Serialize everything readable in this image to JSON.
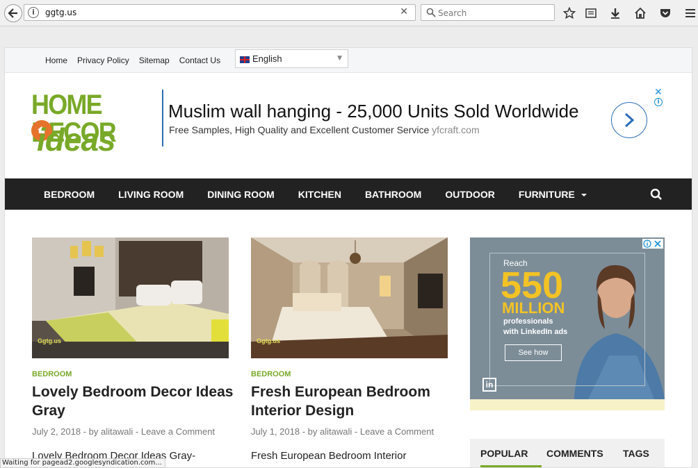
{
  "browser": {
    "url": "ggtg.us",
    "search_placeholder": "Search",
    "status_text": "Waiting for pagead2.googlesyndication.com..."
  },
  "topnav": {
    "items": [
      "Home",
      "Privacy Policy",
      "Sitemap",
      "Contact Us"
    ],
    "language": "English"
  },
  "logo": {
    "line1": "HOME DECOR",
    "line2": "ideas"
  },
  "ad_banner": {
    "headline": "Muslim wall hanging - 25,000 Units Sold Worldwide",
    "subtext": "Free Samples, High Quality and Excellent Customer Service",
    "domain": "yfcraft.com",
    "close": "✕",
    "info": "i"
  },
  "mainnav": {
    "items": [
      "BEDROOM",
      "LIVING ROOM",
      "DINING ROOM",
      "KITCHEN",
      "BATHROOM",
      "OUTDOOR",
      "FURNITURE"
    ]
  },
  "posts": [
    {
      "category": "BEDROOM",
      "title": "Lovely Bedroom Decor Ideas Gray",
      "date": "July 2, 2018",
      "by": "by",
      "author": "alitawali",
      "comment": "Leave a Comment",
      "excerpt": "Lovely Bedroom Decor Ideas Gray-",
      "watermark": "Ggtg.us"
    },
    {
      "category": "BEDROOM",
      "title": "Fresh European Bedroom Interior Design",
      "date": "July 1, 2018",
      "by": "by",
      "author": "alitawali",
      "comment": "Leave a Comment",
      "excerpt": "Fresh European Bedroom Interior",
      "watermark": "Ggtg.us"
    }
  ],
  "sidebar_ad": {
    "reach": "Reach",
    "number": "550",
    "million": "MILLION",
    "line1": "professionals",
    "line2": "with LinkedIn ads",
    "cta": "See how",
    "logo": "in"
  },
  "sidebar_tabs": [
    "POPULAR",
    "COMMENTS",
    "TAGS"
  ],
  "colors": {
    "accent": "#79a928",
    "nav_bg": "#222222",
    "ad_blue": "#2a6db5"
  }
}
